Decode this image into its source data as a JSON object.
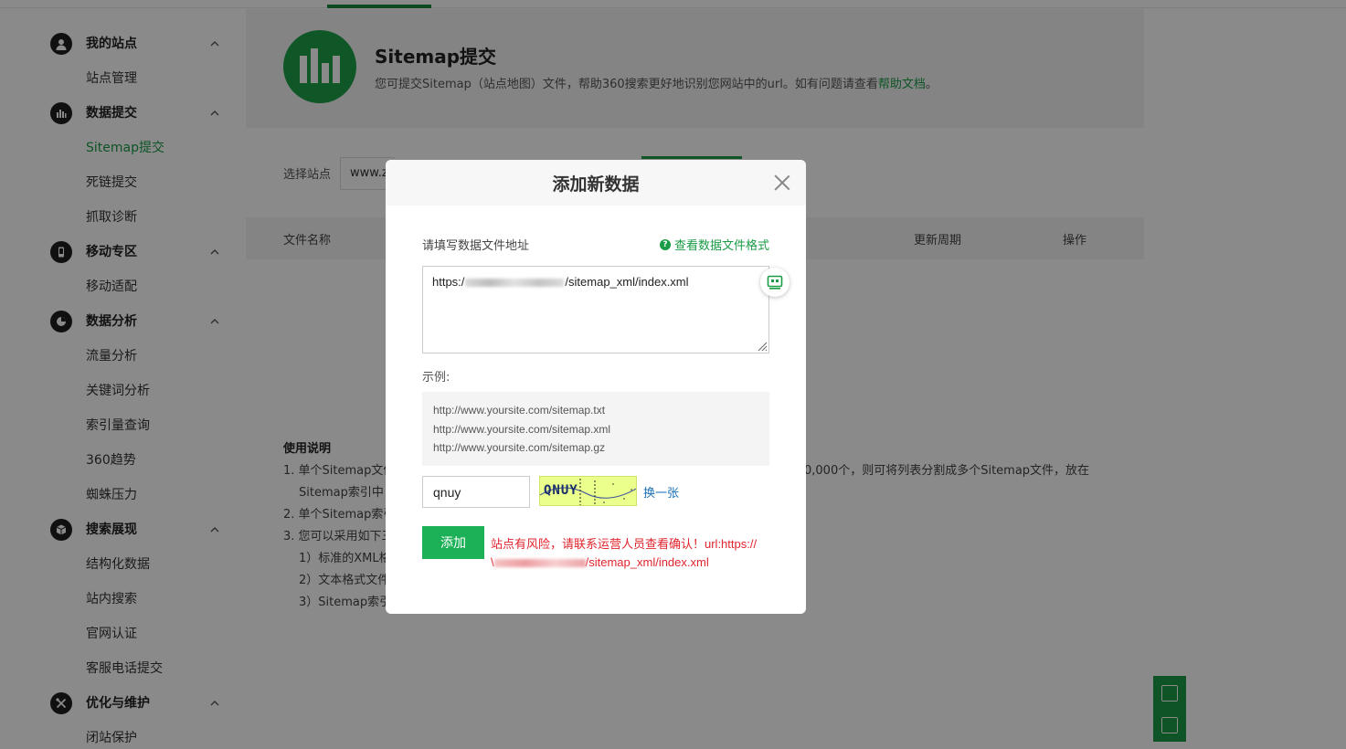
{
  "sidebar": {
    "groups": [
      {
        "title": "我的站点",
        "items": [
          "站点管理"
        ]
      },
      {
        "title": "数据提交",
        "items": [
          "Sitemap提交",
          "死链提交",
          "抓取诊断"
        ]
      },
      {
        "title": "移动专区",
        "items": [
          "移动适配"
        ]
      },
      {
        "title": "数据分析",
        "items": [
          "流量分析",
          "关键词分析",
          "索引量查询",
          "360趋势",
          "蜘蛛压力"
        ]
      },
      {
        "title": "搜索展现",
        "items": [
          "结构化数据",
          "站内搜索",
          "官网认证",
          "客服电话提交"
        ]
      },
      {
        "title": "优化与维护",
        "items": [
          "闭站保护"
        ]
      }
    ],
    "active_item": "Sitemap提交"
  },
  "banner": {
    "title": "Sitemap提交",
    "desc_prefix": "您可提交Sitemap（站点地图）文件，帮助360搜索更好地识别您网站中的url。如有问题请查看",
    "desc_link": "帮助文档",
    "desc_suffix": "。"
  },
  "filter": {
    "site_label": "选择站点",
    "site_value": "www.zi"
  },
  "table": {
    "col_filename": "文件名称",
    "col_cycle": "更新周期",
    "col_action": "操作"
  },
  "usage": {
    "title": "使用说明",
    "line1_start": "1. 单个Sitemap文件",
    "line1_end": "0,000个，则可将列表分割成多个Sitemap文件，放在",
    "line1_cont": "Sitemap索引中",
    "line2": "2. 单个Sitemap索引",
    "line3": "3. 您可以采用如下三",
    "sub1": "1）标准的XML格",
    "sub2": "2）文本格式文件",
    "sub3": "3）Sitemap索引"
  },
  "modal": {
    "title": "添加新数据",
    "field_label": "请填写数据文件地址",
    "format_link": "查看数据文件格式",
    "url_prefix": "https:/",
    "url_suffix": "/sitemap_xml/index.xml",
    "example_label": "示例:",
    "examples": [
      "http://www.yoursite.com/sitemap.txt",
      "http://www.yoursite.com/sitemap.xml",
      "http://www.yoursite.com/sitemap.gz"
    ],
    "captcha_value": "qnuy",
    "captcha_code": "QNUY",
    "captcha_refresh": "换一张",
    "add_button": "添加",
    "risk_line1": "站点有风险，请联系运营人员查看确认！url:https://",
    "risk_line2_prefix": "\\",
    "risk_line2_suffix": "/sitemap_xml/index.xml"
  },
  "colors": {
    "brand_green": "#1a9b46",
    "button_green": "#1db157",
    "error_red": "#e0242d",
    "link_blue": "#1a6fb8"
  }
}
